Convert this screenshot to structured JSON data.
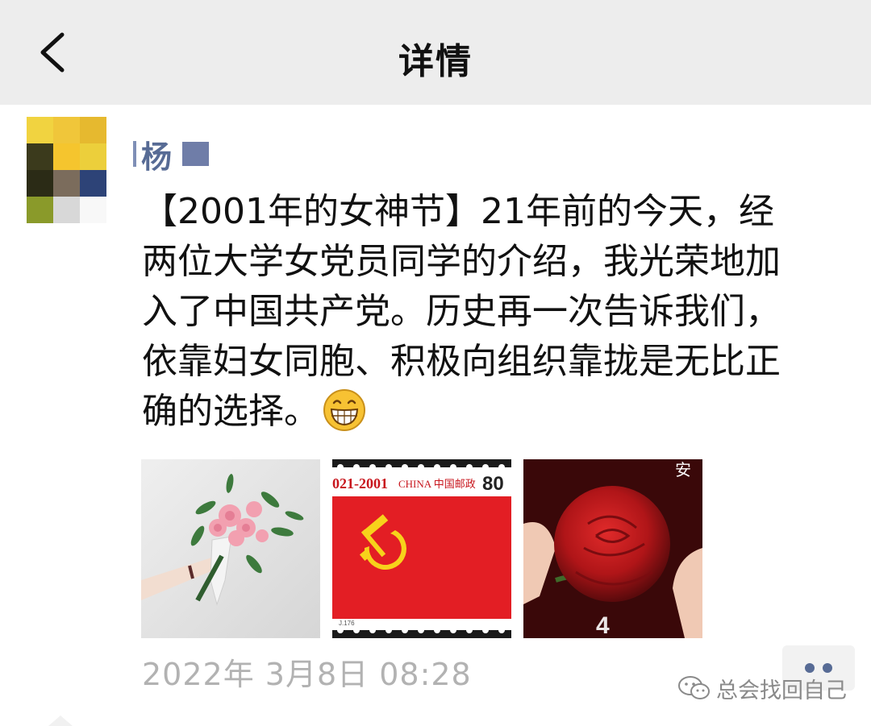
{
  "nav": {
    "title": "详情"
  },
  "post": {
    "author_name": "杨",
    "text_lines": [
      "【2001年的女神节】21年前的今天，经",
      "两位大学女党员同学的介绍，我光荣地加",
      "入了中国共产党。历史再一次告诉我们，",
      "依靠妇女同胞、积极向组织靠拢是无比正",
      "确的选择。"
    ],
    "emoji": "grinning-face",
    "images": [
      {
        "name": "flower-bouquet-image",
        "alt": ""
      },
      {
        "name": "stamp-image",
        "stamp_years": "021-2001",
        "stamp_country": "CHINA 中国邮政",
        "stamp_value": "80"
      },
      {
        "name": "red-rose-image",
        "corner_text": "安"
      }
    ],
    "timestamp": "2022年 3月8日 08:28"
  },
  "watermark": {
    "text": "总会找回自己"
  },
  "colors": {
    "nav_bg": "#ededed",
    "link_blue": "#576b95",
    "text": "#111111",
    "muted": "#b2b2b2"
  }
}
